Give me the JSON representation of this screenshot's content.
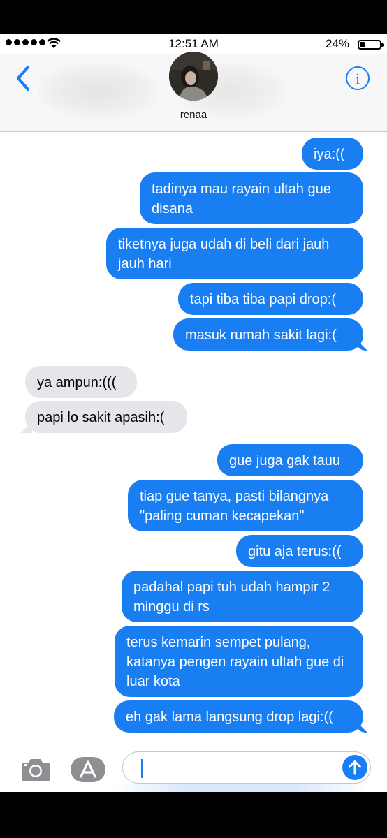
{
  "status_bar": {
    "time": "12:51 AM",
    "battery_percent": "24%",
    "battery_level": 0.24,
    "signal_dots": 5
  },
  "header": {
    "contact_name": "renaa",
    "back_icon": "chevron-left-icon",
    "info_icon": "info-circle-icon",
    "accent_color": "#1a7ef3"
  },
  "messages": [
    {
      "side": "sent",
      "text": "iya:(("
    },
    {
      "side": "sent",
      "text": "tadinya mau rayain ultah gue disana"
    },
    {
      "side": "sent",
      "text": "tiketnya juga udah di beli dari jauh jauh hari"
    },
    {
      "side": "sent",
      "text": "tapi tiba tiba papi drop:("
    },
    {
      "side": "sent",
      "text": "masuk rumah sakit lagi:("
    },
    {
      "side": "recv",
      "text": "ya ampun:((("
    },
    {
      "side": "recv",
      "text": "papi lo sakit apasih:("
    },
    {
      "side": "sent",
      "text": "gue juga gak tauu"
    },
    {
      "side": "sent",
      "text": "tiap gue tanya, pasti bilangnya \"paling cuman kecapekan\""
    },
    {
      "side": "sent",
      "text": "gitu aja terus:(("
    },
    {
      "side": "sent",
      "text": "padahal papi tuh udah hampir 2 minggu di rs"
    },
    {
      "side": "sent",
      "text": "terus kemarin sempet pulang, katanya pengen rayain ultah gue di luar kota"
    },
    {
      "side": "sent",
      "text": "eh gak lama langsung drop lagi:(("
    }
  ],
  "compose": {
    "camera_icon": "camera-icon",
    "appstore_icon": "app-store-icon",
    "send_icon": "send-arrow-up-icon",
    "input_value": ""
  },
  "colors": {
    "sent_bubble": "#1a7ef3",
    "received_bubble": "#e5e5ea"
  }
}
